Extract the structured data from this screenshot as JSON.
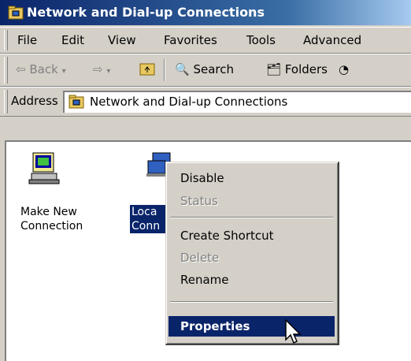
{
  "window": {
    "title": "Network and Dial-up Connections",
    "title_icon": "folder-network-icon"
  },
  "menubar": {
    "items": [
      "File",
      "Edit",
      "View",
      "Favorites",
      "Tools",
      "Advanced"
    ]
  },
  "toolbar": {
    "back_label": "Back",
    "search_label": "Search",
    "folders_label": "Folders"
  },
  "address": {
    "label": "Address",
    "value": "Network and Dial-up Connections"
  },
  "icons": [
    {
      "name": "make-new-connection",
      "line1": "Make New",
      "line2": "Connection"
    },
    {
      "name": "local-area-connection",
      "line1": "Loca",
      "line2": "Conn"
    }
  ],
  "context_menu": {
    "items": [
      {
        "label": "Disable",
        "enabled": true
      },
      {
        "label": "Status",
        "enabled": false
      },
      {
        "label": "Create Shortcut",
        "enabled": true
      },
      {
        "label": "Delete",
        "enabled": false
      },
      {
        "label": "Rename",
        "enabled": true
      },
      {
        "label": "Properties",
        "enabled": true,
        "highlighted": true
      }
    ]
  },
  "colors": {
    "title_bar": "#0a246a",
    "selection": "#0a246a",
    "chrome": "#d4d0c8"
  }
}
